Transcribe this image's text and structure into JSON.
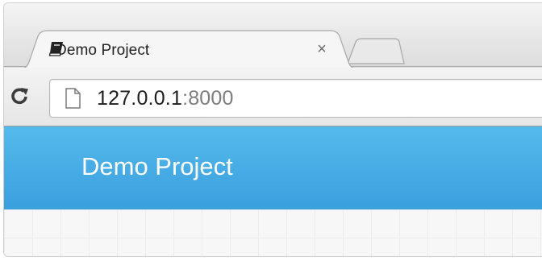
{
  "browser": {
    "tab": {
      "icon": "book-icon",
      "title": "Demo Project",
      "close_glyph": "×"
    },
    "new_tab_icon": "new-tab-icon",
    "reload_icon": "reload-icon",
    "address_bar": {
      "page_icon": "page-icon",
      "url_host": "127.0.0.1",
      "url_port": ":8000"
    }
  },
  "page": {
    "navbar": {
      "brand": "Demo Project",
      "color": "#48adE6"
    }
  }
}
